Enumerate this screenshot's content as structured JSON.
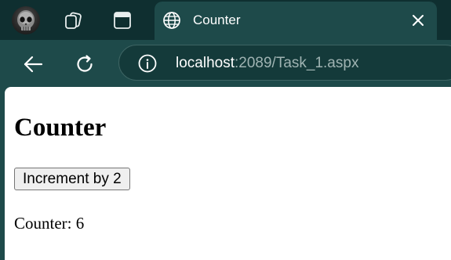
{
  "tab": {
    "title": "Counter",
    "favicon": "globe-icon",
    "close": "close-icon"
  },
  "toolbar": {
    "back": "back-arrow-icon",
    "reload": "reload-icon",
    "url_host": "localhost",
    "url_rest": ":2089/Task_1.aspx"
  },
  "page": {
    "heading": "Counter",
    "button_label": "Increment by 2",
    "counter_label": "Counter:",
    "counter_value": "6"
  },
  "colors": {
    "tabstrip": "#0f2f30",
    "toolbar": "#1e4a4a",
    "omnibox": "#143a3a"
  }
}
